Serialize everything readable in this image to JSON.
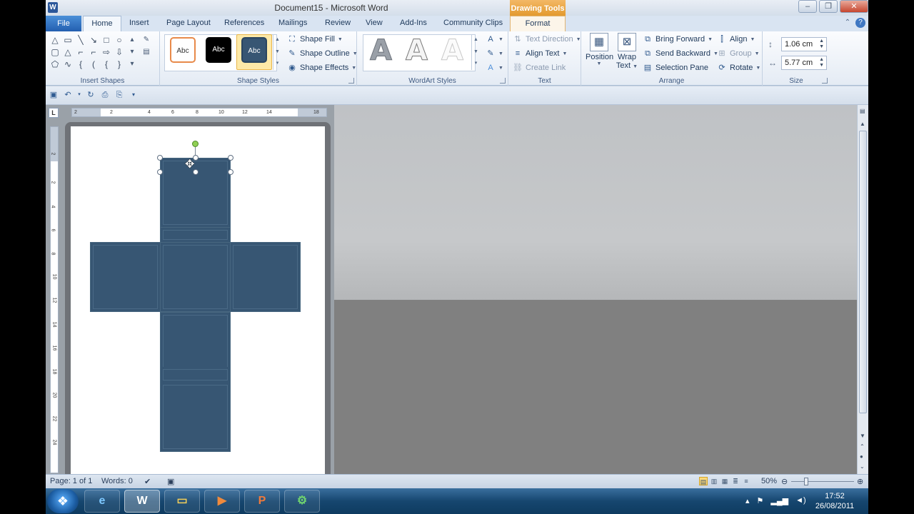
{
  "window": {
    "title": "Document15 - Microsoft Word",
    "contextual_tab_group": "Drawing Tools"
  },
  "tabs": [
    "File",
    "Home",
    "Insert",
    "Page Layout",
    "References",
    "Mailings",
    "Review",
    "View",
    "Add-Ins",
    "Community Clips",
    "Format"
  ],
  "ribbon": {
    "insert_shapes": {
      "label": "Insert Shapes"
    },
    "shape_styles": {
      "label": "Shape Styles",
      "style_preview_text": "Abc",
      "shape_fill": "Shape Fill",
      "shape_outline": "Shape Outline",
      "shape_effects": "Shape Effects"
    },
    "wordart_styles": {
      "label": "WordArt Styles",
      "letter": "A"
    },
    "text": {
      "label": "Text",
      "text_direction": "Text Direction",
      "align_text": "Align Text",
      "create_link": "Create Link"
    },
    "arrange": {
      "label": "Arrange",
      "position": "Position",
      "wrap_text_1": "Wrap",
      "wrap_text_2": "Text",
      "bring_forward": "Bring Forward",
      "send_backward": "Send Backward",
      "selection_pane": "Selection Pane",
      "align": "Align",
      "group": "Group",
      "rotate": "Rotate"
    },
    "size": {
      "label": "Size",
      "height": "1.06 cm",
      "width": "5.77 cm"
    }
  },
  "ruler": {
    "horizontal_ticks": [
      "2",
      "2",
      "4",
      "6",
      "8",
      "10",
      "12",
      "14",
      "18"
    ],
    "vertical_ticks": [
      "2",
      "2",
      "4",
      "6",
      "8",
      "10",
      "12",
      "14",
      "16",
      "18",
      "20",
      "22",
      "24"
    ]
  },
  "status": {
    "page": "Page: 1 of 1",
    "words": "Words: 0",
    "zoom": "50%"
  },
  "taskbar": {
    "time": "17:52",
    "date": "26/08/2011"
  },
  "colors": {
    "shape_fill": "#375673",
    "file_tab": "#2b66b8",
    "contextual_header": "#e9a544"
  }
}
